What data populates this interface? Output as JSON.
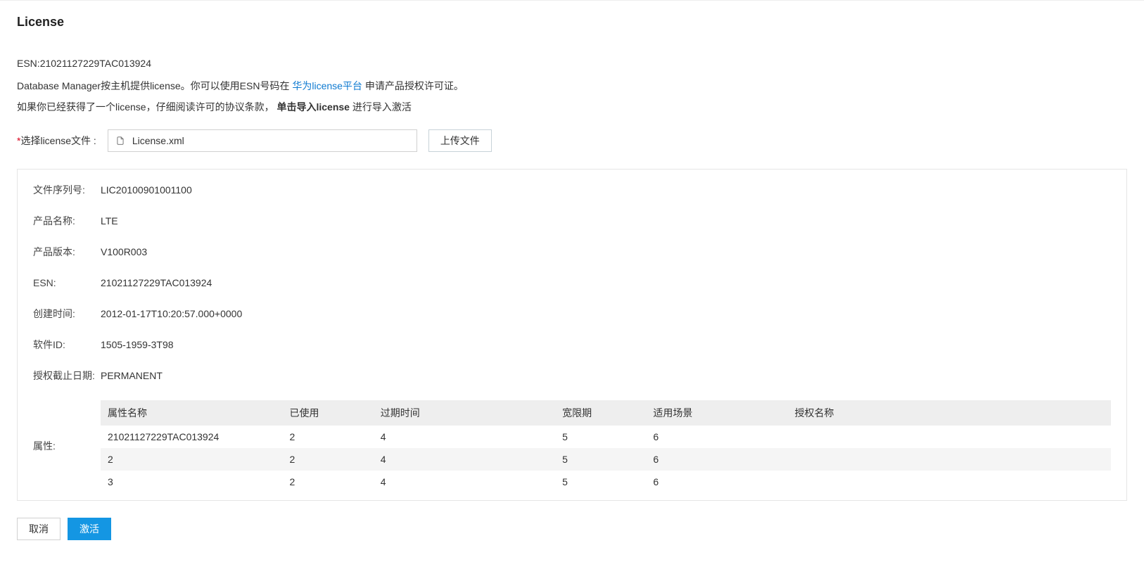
{
  "title": "License",
  "esn": {
    "label": "ESN:",
    "value": "21021127229TAC013924"
  },
  "intro": {
    "part1": "Database Manager按主机提供license。你可以使用ESN号码在 ",
    "link_text": "华为license平台",
    "part2": " 申请产品授权许可证。",
    "line2_a": "如果你已经获得了一个license，仔细阅读许可的协议条款，",
    "line2_bold": "单击导入license",
    "line2_b": "进行导入激活"
  },
  "select": {
    "required_mark": "*",
    "label": "选择license文件 :",
    "file_name": "License.xml",
    "upload_label": "上传文件"
  },
  "details": {
    "rows": [
      {
        "label": "文件序列号:",
        "value": "LIC20100901001100"
      },
      {
        "label": "产品名称:",
        "value": "LTE"
      },
      {
        "label": "产品版本:",
        "value": "V100R003"
      },
      {
        "label": "ESN:",
        "value": "21021127229TAC013924"
      },
      {
        "label": "创建时间:",
        "value": "2012-01-17T10:20:57.000+0000"
      },
      {
        "label": "软件ID:",
        "value": "1505-1959-3T98"
      },
      {
        "label": "授权截止日期:",
        "value": "PERMANENT"
      }
    ],
    "attr_label": "属性:",
    "attr_table": {
      "headers": [
        "属性名称",
        "已使用",
        "过期时间",
        "宽限期",
        "适用场景",
        "授权名称"
      ],
      "rows": [
        [
          "21021127229TAC013924",
          "2",
          "4",
          "5",
          "6",
          ""
        ],
        [
          "2",
          "2",
          "4",
          "5",
          "6",
          ""
        ],
        [
          "3",
          "2",
          "4",
          "5",
          "6",
          ""
        ]
      ]
    }
  },
  "footer": {
    "cancel": "取消",
    "activate": "激活"
  }
}
